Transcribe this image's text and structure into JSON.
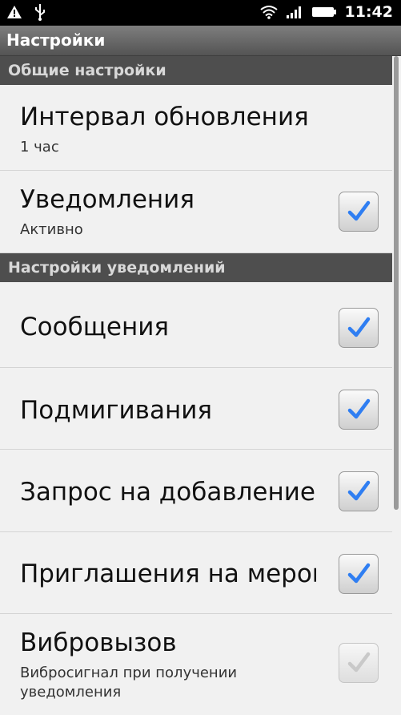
{
  "status_bar": {
    "time": "11:42",
    "icons": [
      "warning-icon",
      "usb-icon",
      "wifi-icon",
      "signal-icon",
      "battery-icon"
    ]
  },
  "title": "Настройки",
  "sections": [
    {
      "header": "Общие настройки"
    },
    {
      "header": "Настройки уведомлений"
    }
  ],
  "general": {
    "interval": {
      "title": "Интервал обновления",
      "summary": "1 час"
    },
    "notifications": {
      "title": "Уведомления",
      "summary": "Активно",
      "checked": true
    }
  },
  "notification_settings": {
    "messages": {
      "title": "Сообщения",
      "checked": true
    },
    "pokes": {
      "title": "Подмигивания",
      "checked": true
    },
    "friend_requests": {
      "title": "Запрос на добавление в",
      "checked": true
    },
    "event_invites": {
      "title": "Приглашения на мероп",
      "checked": true
    },
    "vibration": {
      "title": "Вибровызов",
      "summary": "Вибросигнал при получении уведомления",
      "checked": true,
      "enabled": false
    }
  },
  "colors": {
    "check_active": "#2f7ef2",
    "check_disabled": "#c9c9c9",
    "section_bg": "#4e4e4e",
    "title_bar": "#6a6a6a"
  }
}
